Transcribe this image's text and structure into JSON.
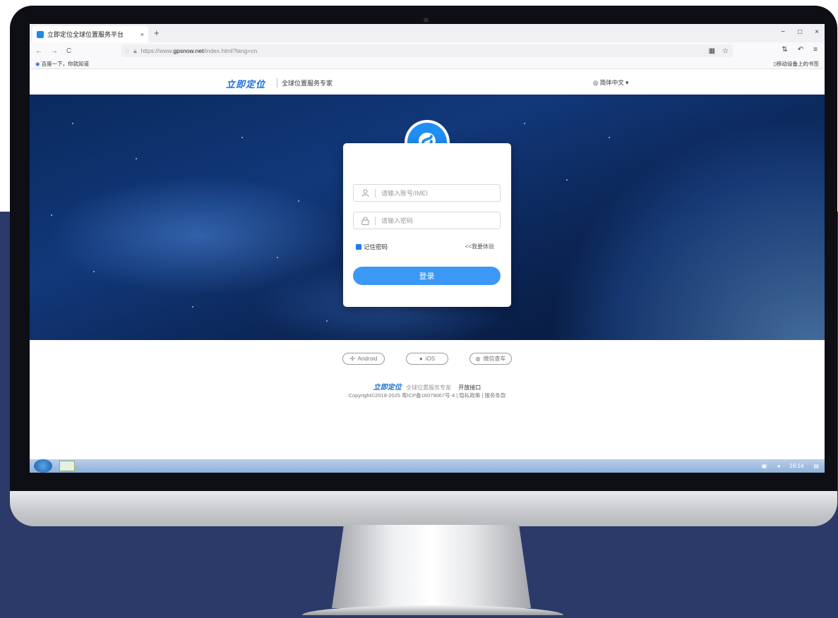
{
  "browser": {
    "tab_title": "立即定位全球位置服务平台",
    "tab_close": "×",
    "new_tab": "+",
    "window_controls": [
      "−",
      "□",
      "×"
    ],
    "nav_buttons": [
      "←",
      "→",
      "C"
    ],
    "url_scheme": "https://www.",
    "url_host": "gpsnow.net",
    "url_path": "/index.html?lang=cn",
    "bookmark_left": "百度一下，你就知道",
    "bookmark_right": "移动设备上的书签"
  },
  "site": {
    "logo_text": "立即定位",
    "slogan": "全球位置服务专家",
    "language": "简体中文 ▾"
  },
  "login": {
    "account_placeholder": "请输入账号/IMEI",
    "password_placeholder": "请输入密码",
    "remember_label": "记住密码",
    "trial_link": "<<我要体验",
    "submit_label": "登录"
  },
  "footer": {
    "apps": [
      {
        "label": "Android",
        "icon": "android-icon"
      },
      {
        "label": "iOS",
        "icon": "apple-icon"
      },
      {
        "label": "微信查车",
        "icon": "wechat-icon"
      }
    ],
    "logo_text": "立即定位",
    "slogan": "全球位置服务专家",
    "api_link": "开放接口",
    "copyright": "Copyright©2018-2025 粤ICP备16079067号-4 | 隐私政策 | 服务条款"
  },
  "taskbar": {
    "clock": "16:14"
  },
  "colors": {
    "accent": "#1f8ef5",
    "button": "#3b99f5",
    "logo": "#1a6fd8",
    "backdrop": "#2b3a68"
  }
}
